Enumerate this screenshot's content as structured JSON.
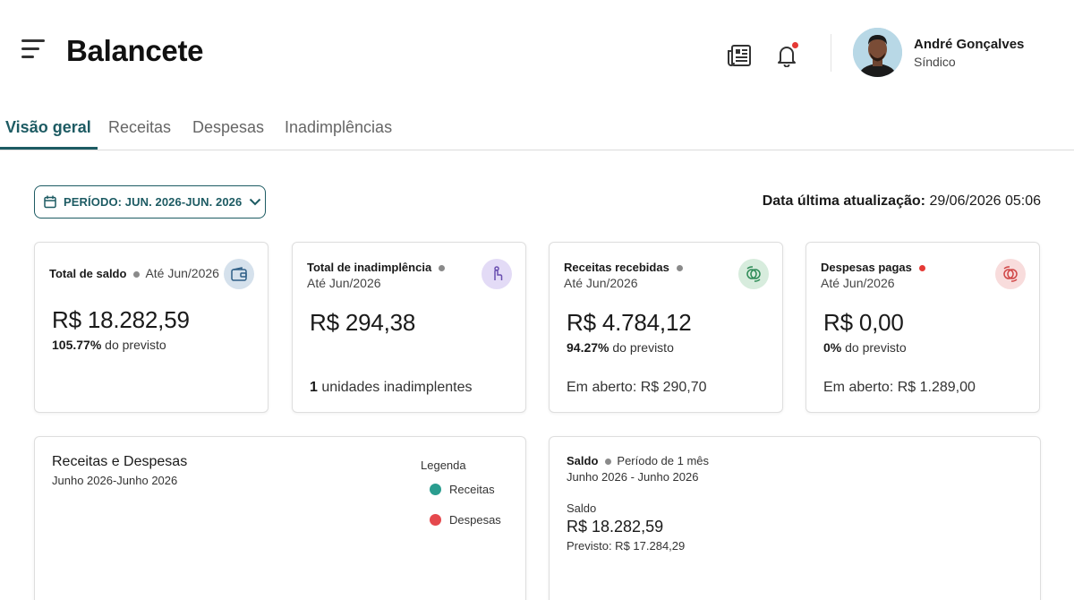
{
  "header": {
    "title": "Balancete",
    "notification_dot_color": "#e53935",
    "user": {
      "name": "André Gonçalves",
      "role": "Síndico"
    }
  },
  "tabs": [
    {
      "label": "Visão geral",
      "active": true
    },
    {
      "label": "Receitas",
      "active": false
    },
    {
      "label": "Despesas",
      "active": false
    },
    {
      "label": "Inadimplências",
      "active": false
    }
  ],
  "period": {
    "label": "PERÍODO: JUN. 2026-JUN. 2026"
  },
  "last_update": {
    "label": "Data última atualização:",
    "value": "29/06/2026 05:06"
  },
  "cards": [
    {
      "title": "Total de saldo",
      "subtitle": "Até Jun/2026",
      "dot_color": "#8a8a8a",
      "icon": "wallet-icon",
      "icon_bg": "#d5e1ec",
      "value": "R$ 18.282,59",
      "pct": "105.77%",
      "pct_suffix": "do previsto"
    },
    {
      "title": "Total de inadimplência",
      "subtitle": "Até Jun/2026",
      "dot_color": "#8a8a8a",
      "icon": "hand-coin-icon",
      "icon_bg": "#e3dbf6",
      "value": "R$ 294,38",
      "foot_count": "1",
      "foot_text": "unidades inadimplentes"
    },
    {
      "title": "Receitas recebidas",
      "subtitle": "Até Jun/2026",
      "dot_color": "#8a8a8a",
      "icon": "money-exchange-icon",
      "icon_bg": "#d7ecdd",
      "value": "R$ 4.784,12",
      "pct": "94.27%",
      "pct_suffix": "do previsto",
      "foot_text": "Em aberto: R$ 290,70"
    },
    {
      "title": "Despesas pagas",
      "subtitle": "Até Jun/2026",
      "dot_color": "#e53935",
      "icon": "money-exchange-icon",
      "icon_bg": "#f8dcdc",
      "value": "R$ 0,00",
      "pct": "0%",
      "pct_suffix": "do previsto",
      "foot_text": "Em aberto: R$ 1.289,00"
    }
  ],
  "chart_panel": {
    "title": "Receitas e Despesas",
    "subtitle": "Junho 2026-Junho 2026",
    "legend_title": "Legenda",
    "legend": [
      {
        "label": "Receitas",
        "color": "#2a9d8f"
      },
      {
        "label": "Despesas",
        "color": "#e5484d"
      }
    ]
  },
  "saldo_panel": {
    "title": "Saldo",
    "period": "Período de 1 mês",
    "range": "Junho 2026 - Junho 2026",
    "label": "Saldo",
    "value": "R$ 18.282,59",
    "previsto": "Previsto: R$ 17.284,29"
  },
  "colors": {
    "accent": "#1d5b63"
  }
}
